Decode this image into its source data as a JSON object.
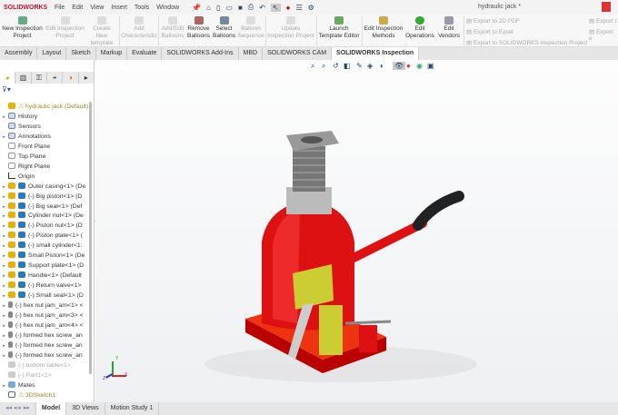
{
  "app": {
    "logo": "SOLIDWORKS",
    "title": "hydraulic jack *"
  },
  "menu": [
    "File",
    "Edit",
    "View",
    "Insert",
    "Tools",
    "Window"
  ],
  "ribbon": {
    "new_inspection_project": "New Inspection Project",
    "edit_inspection_project": "Edit Inspection Project",
    "create_new_template": "Create New template",
    "add_characteristic": "Add Characteristic",
    "add_edit_balloons": "Add/Edit Balloons",
    "remove_balloons": "Remove Balloons",
    "select_balloons": "Select Balloons",
    "balloon_sequence": "Balloon Sequence",
    "update_inspection_project": "Update Inspection Project",
    "launch_template_editor": "Launch Template Editor",
    "edit_inspection_methods": "Edit Inspection Methods",
    "edit_operations": "Edit Operations",
    "edit_vendors": "Edit Vendors",
    "export_2d_pdf": "Export to 2D PDF",
    "export_excel": "Export to Excel",
    "export_project": "Export to SOLIDWORKS Inspection Project",
    "export_t": "Export t",
    "export_e": "Export e"
  },
  "tabs": [
    "Assembly",
    "Layout",
    "Sketch",
    "Markup",
    "Evaluate",
    "SOLIDWORKS Add-Ins",
    "MBD",
    "SOLIDWORKS CAM",
    "SOLIDWORKS Inspection"
  ],
  "tree": [
    {
      "label": "hydraulic jack  (Default)",
      "type": "root"
    },
    {
      "label": "History",
      "type": "folder",
      "arrow": true
    },
    {
      "label": "Sensors",
      "type": "folder"
    },
    {
      "label": "Annotations",
      "type": "folder",
      "arrow": true
    },
    {
      "label": "Front Plane",
      "type": "plane"
    },
    {
      "label": "Top Plane",
      "type": "plane"
    },
    {
      "label": "Right Plane",
      "type": "plane"
    },
    {
      "label": "Origin",
      "type": "origin"
    },
    {
      "label": "Outer casing<1> (De",
      "type": "part",
      "arrow": true
    },
    {
      "label": "(-) Big piston<1> (D",
      "type": "part",
      "arrow": true
    },
    {
      "label": "(-) Big seal<1> (Def",
      "type": "part",
      "arrow": true
    },
    {
      "label": "Cylinder nut<1> (De",
      "type": "part",
      "arrow": true
    },
    {
      "label": "(-) Piston nut<1> (D",
      "type": "part",
      "arrow": true
    },
    {
      "label": "(-) Piston plate<1> (",
      "type": "part",
      "arrow": true
    },
    {
      "label": "(-) small cylinder<1:",
      "type": "part",
      "arrow": true
    },
    {
      "label": "Small Piston<1> (De",
      "type": "part",
      "arrow": true
    },
    {
      "label": "Support plate<1> (D",
      "type": "part",
      "arrow": true
    },
    {
      "label": "Handle<1> (Default",
      "type": "part",
      "arrow": true
    },
    {
      "label": "(-) Return valve<1>",
      "type": "part",
      "arrow": true
    },
    {
      "label": "(-) Small seal<1> (D",
      "type": "part",
      "arrow": true
    },
    {
      "label": "(-) hex nut jam_am<1> <",
      "type": "hw",
      "arrow": true
    },
    {
      "label": "(-) hex nut jam_am<3> <",
      "type": "hw",
      "arrow": true
    },
    {
      "label": "(-) hex nut jam_am<4> <",
      "type": "hw",
      "arrow": true
    },
    {
      "label": "(-) formed hex screw_an",
      "type": "hw",
      "arrow": true
    },
    {
      "label": "(-) formed hex screw_an",
      "type": "hw",
      "arrow": true
    },
    {
      "label": "(-) formed hex screw_an",
      "type": "hw",
      "arrow": true
    },
    {
      "label": "(-) bottom table<1>",
      "type": "supp"
    },
    {
      "label": "(-) Part1<1>",
      "type": "supp"
    },
    {
      "label": "Mates",
      "type": "mates",
      "arrow": true
    },
    {
      "label": "3DSketch1",
      "type": "sketch"
    }
  ],
  "bottom_tabs": [
    "Model",
    "3D Views",
    "Motion Study 1"
  ],
  "triad": {
    "x": "X",
    "y": "Y",
    "z": "Z"
  }
}
